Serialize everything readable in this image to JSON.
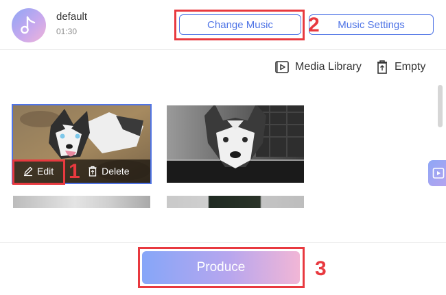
{
  "header": {
    "track_title": "default",
    "track_duration": "01:30",
    "change_music_label": "Change Music",
    "music_settings_label": "Music Settings"
  },
  "toolbar": {
    "media_library_label": "Media Library",
    "empty_label": "Empty"
  },
  "media": {
    "selected_item": {
      "edit_label": "Edit",
      "delete_label": "Delete"
    }
  },
  "footer": {
    "produce_label": "Produce"
  },
  "annotations": {
    "marker_1": "1",
    "marker_2": "2",
    "marker_3": "3",
    "highlight_color": "#e8393f"
  },
  "colors": {
    "accent": "#4f74e6",
    "gradient_start": "#86a6f8",
    "gradient_end": "#f1b6d6"
  },
  "icons": [
    "music-note-icon",
    "media-library-icon",
    "trash-icon",
    "pencil-icon",
    "play-icon"
  ]
}
